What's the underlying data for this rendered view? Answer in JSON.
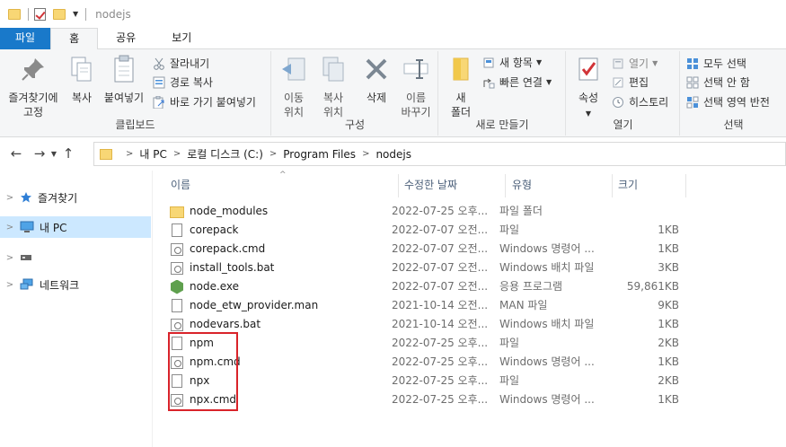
{
  "window": {
    "title": "nodejs"
  },
  "ribbon_tabs": [
    "파일",
    "홈",
    "공유",
    "보기"
  ],
  "ribbon": {
    "clipboard": {
      "label": "클립보드",
      "pin": "즐겨찾기에\n고정",
      "copy": "복사",
      "paste": "붙여넣기",
      "cut": "잘라내기",
      "copy_path": "경로 복사",
      "paste_shortcut": "바로 가기 붙여넣기"
    },
    "organize": {
      "label": "구성",
      "move_to": "이동\n위치",
      "copy_to": "복사\n위치",
      "delete": "삭제",
      "rename": "이름\n바꾸기"
    },
    "new": {
      "label": "새로 만들기",
      "new_folder": "새\n폴더",
      "new_item": "새 항목",
      "easy_access": "빠른 연결"
    },
    "open": {
      "label": "열기",
      "properties": "속성",
      "open": "열기",
      "edit": "편집",
      "history": "히스토리"
    },
    "select": {
      "label": "선택",
      "select_all": "모두 선택",
      "select_none": "선택 안 함",
      "invert": "선택 영역 반전"
    }
  },
  "address": {
    "crumbs": [
      "내 PC",
      "로컬 디스크 (C:)",
      "Program Files",
      "nodejs"
    ]
  },
  "navpane": {
    "items": [
      {
        "label": "즐겨찾기",
        "icon": "star-icon"
      },
      {
        "label": "내 PC",
        "icon": "pc-icon",
        "selected": true
      },
      {
        "label": "",
        "icon": "drive-icon"
      },
      {
        "label": "네트워크",
        "icon": "network-icon"
      }
    ]
  },
  "columns": {
    "name": "이름",
    "date": "수정한 날짜",
    "type": "유형",
    "size": "크기"
  },
  "files": [
    {
      "name": "node_modules",
      "date": "2022-07-25 오후...",
      "type": "파일 폴더",
      "size": "",
      "icon": "folder"
    },
    {
      "name": "corepack",
      "date": "2022-07-07 오전...",
      "type": "파일",
      "size": "1KB",
      "icon": "file"
    },
    {
      "name": "corepack.cmd",
      "date": "2022-07-07 오전...",
      "type": "Windows 명령어 ...",
      "size": "1KB",
      "icon": "gear"
    },
    {
      "name": "install_tools.bat",
      "date": "2022-07-07 오전...",
      "type": "Windows 배치 파일",
      "size": "3KB",
      "icon": "gear"
    },
    {
      "name": "node.exe",
      "date": "2022-07-07 오전...",
      "type": "응용 프로그램",
      "size": "59,861KB",
      "icon": "node"
    },
    {
      "name": "node_etw_provider.man",
      "date": "2021-10-14 오전...",
      "type": "MAN 파일",
      "size": "9KB",
      "icon": "file"
    },
    {
      "name": "nodevars.bat",
      "date": "2021-10-14 오전...",
      "type": "Windows 배치 파일",
      "size": "1KB",
      "icon": "gear"
    },
    {
      "name": "npm",
      "date": "2022-07-25 오후...",
      "type": "파일",
      "size": "2KB",
      "icon": "file"
    },
    {
      "name": "npm.cmd",
      "date": "2022-07-25 오후...",
      "type": "Windows 명령어 ...",
      "size": "1KB",
      "icon": "gear"
    },
    {
      "name": "npx",
      "date": "2022-07-25 오후...",
      "type": "파일",
      "size": "2KB",
      "icon": "file"
    },
    {
      "name": "npx.cmd",
      "date": "2022-07-25 오후...",
      "type": "Windows 명령어 ...",
      "size": "1KB",
      "icon": "gear"
    }
  ],
  "colors": {
    "accent": "#1979ca",
    "selection": "#cce8ff",
    "highlight": "#d9232a"
  }
}
